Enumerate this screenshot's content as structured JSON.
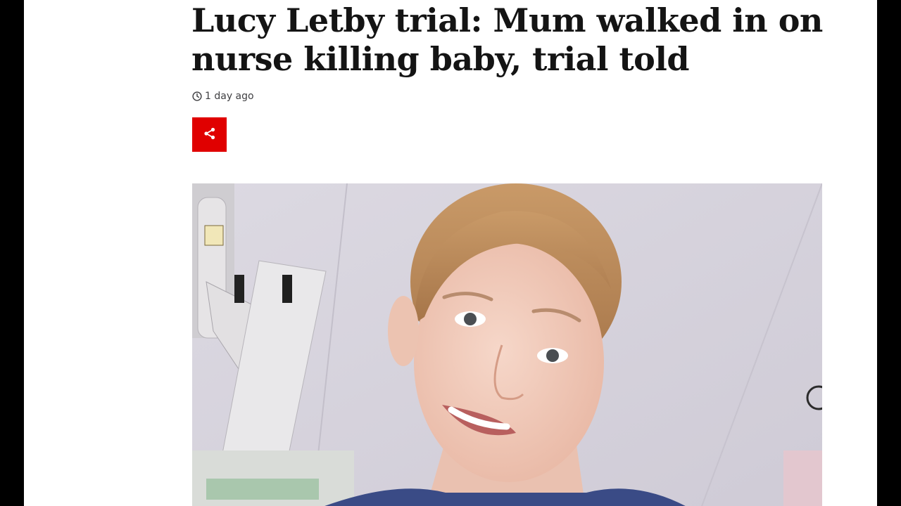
{
  "article": {
    "headline": "Lucy Letby trial: Mum walked in on nurse killing baby, trial told",
    "timestamp": "1 day ago"
  },
  "icons": {
    "timestamp_icon": "clock-icon",
    "share_icon": "share-icon"
  },
  "colors": {
    "share_button": "#e00000",
    "headline": "#141414",
    "frame": "#000000"
  }
}
